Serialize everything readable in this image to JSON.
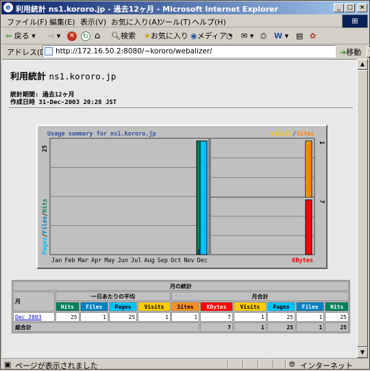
{
  "window": {
    "title": "利用統計 ns1.kororo.jp - 過去12ヶ月 - Microsoft Internet Explorer",
    "icon_name": "ie-icon"
  },
  "menu": [
    "ファイル(F)",
    "編集(E)",
    "表示(V)",
    "お気に入り(A)",
    "ツール(T)",
    "ヘルプ(H)"
  ],
  "toolbar": {
    "back_label": "戻る",
    "search_label": "検索",
    "favorites_label": "お気に入り",
    "media_label": "メディア"
  },
  "address": {
    "label": "アドレス(D)",
    "url": "http://172.16.50.2:8080/~kororo/webalizer/",
    "go_label": "移動"
  },
  "report": {
    "title": "利用統計",
    "host": "ns1.kororo.jp",
    "period": "統計期間: 過去12ヶ月",
    "generated": "作成日時 31-Dec-2003 20:28 JST"
  },
  "chart_data": {
    "type": "bar",
    "title": "Usage summary for ns1.kororo.jp",
    "categories": [
      "Jan",
      "Feb",
      "Mar",
      "Apr",
      "May",
      "Jun",
      "Jul",
      "Aug",
      "Sep",
      "Oct",
      "Nov",
      "Dec"
    ],
    "left_axis_max": "25",
    "left_legend": [
      "Pages",
      "/",
      "Files",
      "/",
      "Hits"
    ],
    "right_top_legend": [
      "Visits",
      "/",
      "Sites"
    ],
    "right_top_max": "1",
    "right_bottom_max": "7",
    "right_bottom_legend": "KBytes",
    "series": [
      {
        "name": "Hits",
        "values": [
          0,
          0,
          0,
          0,
          0,
          0,
          0,
          0,
          0,
          0,
          0,
          25
        ]
      },
      {
        "name": "Files",
        "values": [
          0,
          0,
          0,
          0,
          0,
          0,
          0,
          0,
          0,
          0,
          0,
          1
        ]
      },
      {
        "name": "Pages",
        "values": [
          0,
          0,
          0,
          0,
          0,
          0,
          0,
          0,
          0,
          0,
          0,
          25
        ]
      },
      {
        "name": "Visits",
        "values": [
          0,
          0,
          0,
          0,
          0,
          0,
          0,
          0,
          0,
          0,
          0,
          1
        ]
      },
      {
        "name": "Sites",
        "values": [
          0,
          0,
          0,
          0,
          0,
          0,
          0,
          0,
          0,
          0,
          0,
          1
        ]
      },
      {
        "name": "KBytes",
        "values": [
          0,
          0,
          0,
          0,
          0,
          0,
          0,
          0,
          0,
          0,
          0,
          7
        ]
      }
    ],
    "colors": {
      "hits": "#00805c",
      "files": "#0080c0",
      "pages": "#00c0ff",
      "visits": "#ffcc00",
      "sites": "#ff8000",
      "kbytes": "#ff0000",
      "title": "#3050a0"
    }
  },
  "stats": {
    "caption": "月の統計",
    "month_header": "月",
    "avg_header": "一日あたりの平均",
    "total_header": "月合計",
    "avg_cols": [
      "Hits",
      "Files",
      "Pages",
      "Visits"
    ],
    "total_cols": [
      "Sites",
      "KBytes",
      "Visits",
      "Pages",
      "Files",
      "Hits"
    ],
    "rows": [
      {
        "month": "Dec 2003",
        "values": [
          "25",
          "1",
          "25",
          "1",
          "1",
          "7",
          "1",
          "25",
          "1",
          "25"
        ]
      }
    ],
    "totals_label": "総合計",
    "totals": [
      "7",
      "1",
      "25",
      "1",
      "25"
    ]
  },
  "status": {
    "text": "ページが表示されました",
    "zone": "インターネット"
  }
}
